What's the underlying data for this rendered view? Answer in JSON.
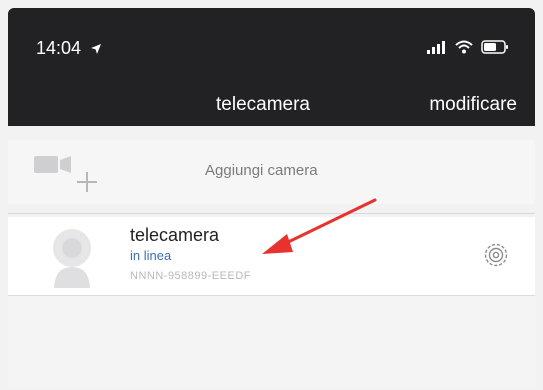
{
  "status_bar": {
    "time": "14:04"
  },
  "nav": {
    "title": "telecamera",
    "edit_label": "modificare"
  },
  "add_camera": {
    "label": "Aggiungi camera"
  },
  "camera": {
    "name": "telecamera",
    "status": "in linea",
    "device_id": "NNNN-958899-EEEDF"
  },
  "colors": {
    "header_bg": "#222224",
    "online_text": "#3b6fbb",
    "arrow": "#e8322e"
  },
  "icons": {
    "location": "location-arrow-icon",
    "signal": "signal-icon",
    "wifi": "wifi-icon",
    "battery": "battery-icon",
    "add_camera": "video-camera-plus-icon",
    "avatar": "camera-avatar-icon",
    "settings": "gear-icon",
    "annotation": "red-arrow-icon"
  }
}
